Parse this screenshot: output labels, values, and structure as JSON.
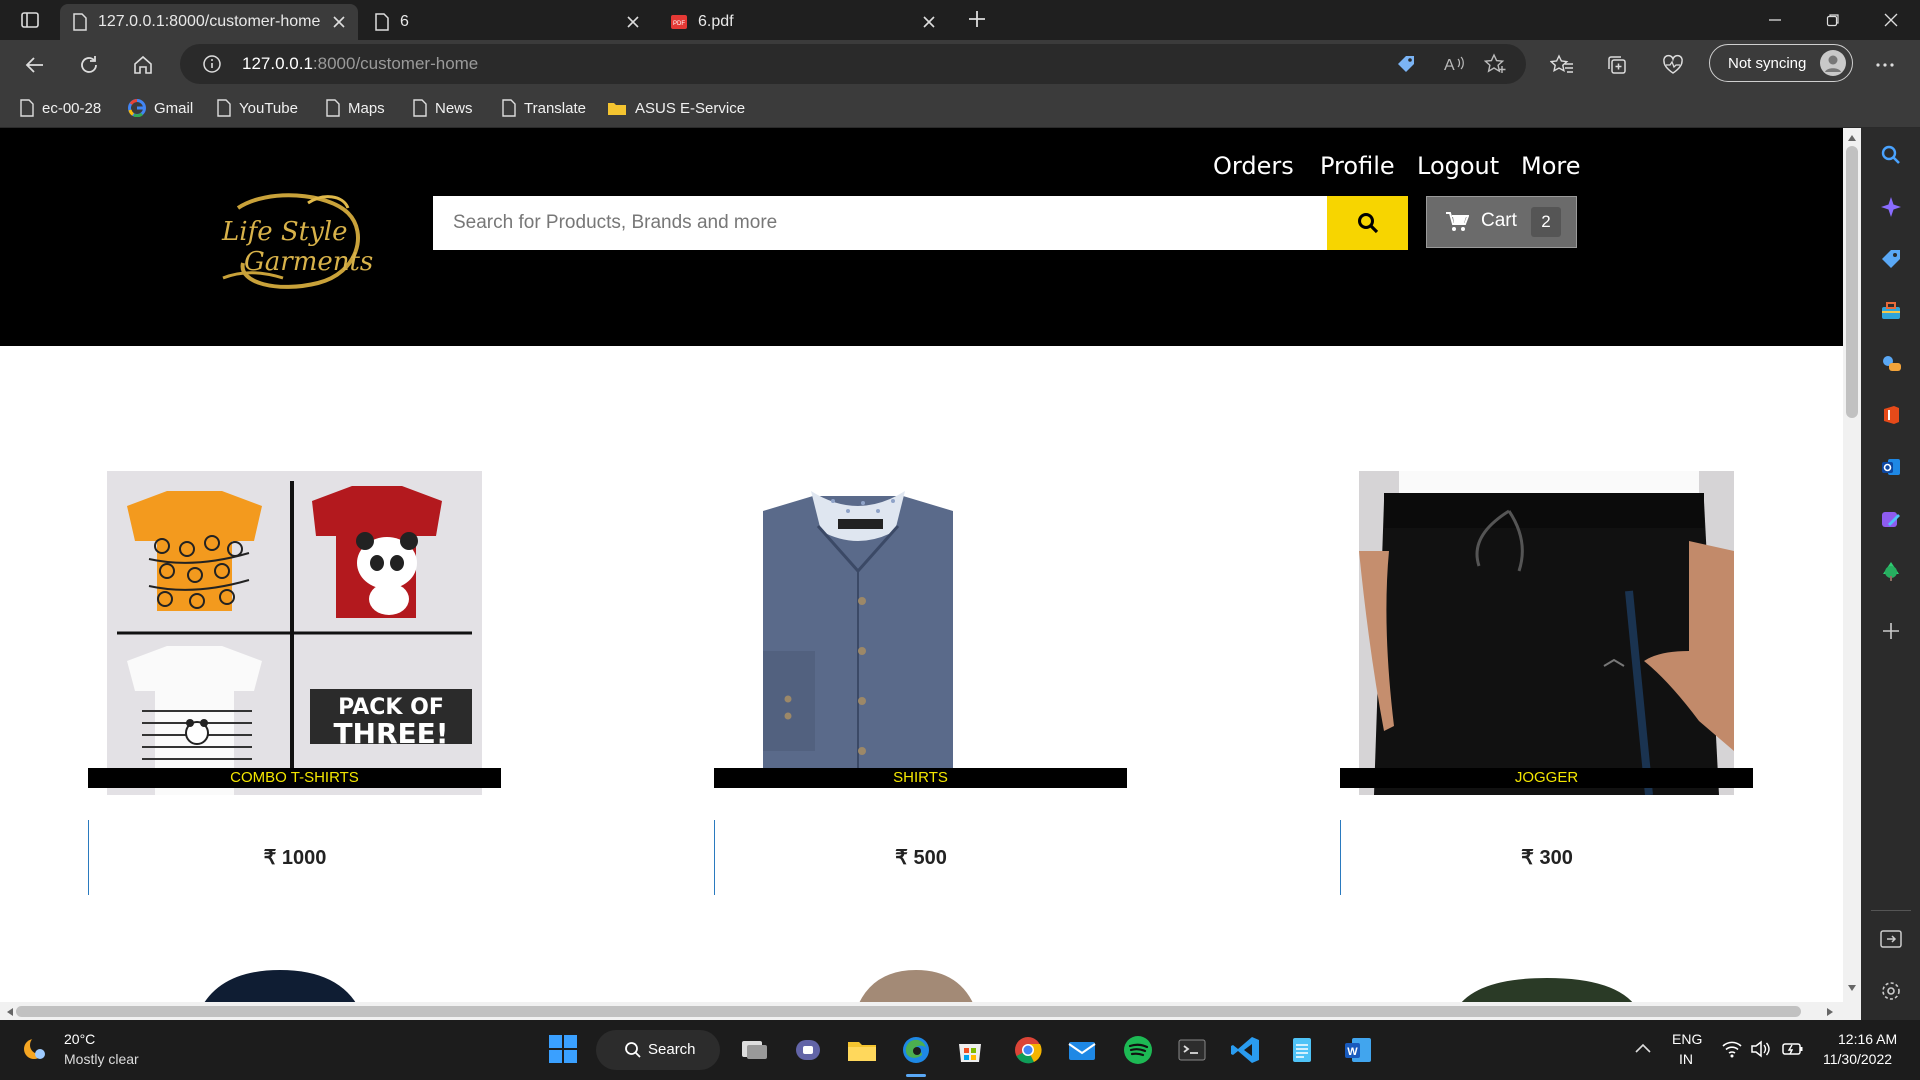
{
  "browser": {
    "tabs": [
      {
        "title": "127.0.0.1:8000/customer-home",
        "active": true
      },
      {
        "title": "6",
        "active": false
      },
      {
        "title": "6.pdf",
        "active": false
      }
    ],
    "url_host": "127.0.0.1",
    "url_path": ":8000/customer-home",
    "sync_label": "Not syncing",
    "bookmarks": [
      "ec-00-28",
      "Gmail",
      "YouTube",
      "Maps",
      "News",
      "Translate",
      "ASUS E-Service"
    ]
  },
  "site": {
    "logo_text_line1": "Life Style",
    "logo_text_line2": "Garments",
    "nav": [
      "Orders",
      "Profile",
      "Logout",
      "More"
    ],
    "search_placeholder": "Search for Products, Brands and more",
    "cart_label": "Cart",
    "cart_count": "2",
    "products": [
      {
        "name": "COMBO T-SHIRTS",
        "price": "₹ 1000",
        "image_text_1": "PACK OF",
        "image_text_2": "THREE!"
      },
      {
        "name": "SHIRTS",
        "price": "₹ 500"
      },
      {
        "name": "JOGGER",
        "price": "₹ 300"
      }
    ]
  },
  "taskbar": {
    "weather_temp": "20°C",
    "weather_desc": "Mostly clear",
    "search_label": "Search",
    "lang_line1": "ENG",
    "lang_line2": "IN",
    "time": "12:16 AM",
    "date": "11/30/2022"
  },
  "colors": {
    "accent_yellow": "#f7d500",
    "label_text": "#f3e600",
    "header_bg": "#000000"
  }
}
